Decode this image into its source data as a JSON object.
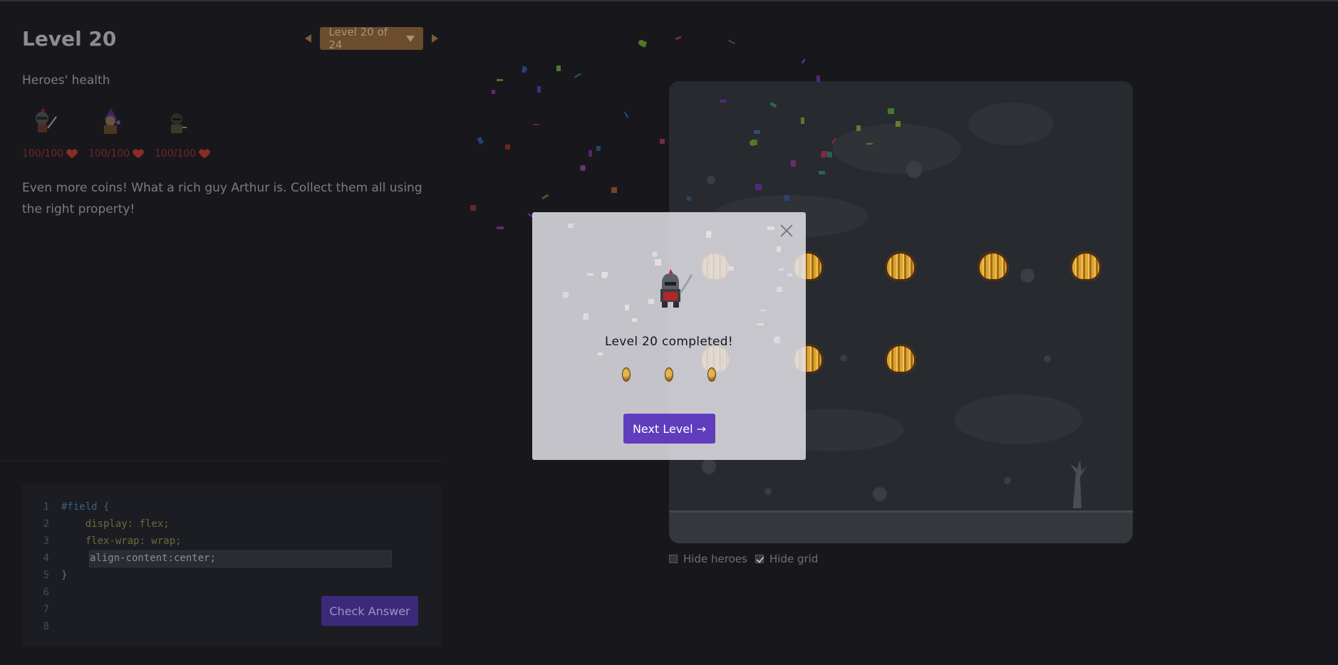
{
  "level": {
    "title": "Level 20",
    "selector_label": "Level 20 of 24"
  },
  "health": {
    "label": "Heroes' health",
    "heroes": [
      {
        "name": "knight",
        "hp": "100/100"
      },
      {
        "name": "wizard",
        "hp": "100/100"
      },
      {
        "name": "rogue",
        "hp": "100/100"
      }
    ]
  },
  "description": "Even more coins! What a rich guy Arthur is. Collect them all using the right property!",
  "editor": {
    "lines": [
      {
        "num": "1",
        "code": "#field {"
      },
      {
        "num": "2",
        "code": "    display: flex;"
      },
      {
        "num": "3",
        "code": "    flex-wrap: wrap;"
      },
      {
        "num": "4",
        "code": ""
      },
      {
        "num": "5",
        "code": "}"
      },
      {
        "num": "6",
        "code": ""
      },
      {
        "num": "7",
        "code": ""
      },
      {
        "num": "8",
        "code": ""
      }
    ],
    "input_value": "align-content:center;",
    "check_button": "Check Answer"
  },
  "field_options": {
    "hide_heroes_label": "Hide heroes",
    "hide_heroes_checked": false,
    "hide_grid_label": "Hide grid",
    "hide_grid_checked": true
  },
  "modal": {
    "title": "Level 20 completed!",
    "next_button": "Next Level →",
    "coins_earned": 3
  },
  "colors": {
    "accent_purple": "#5f3dbd",
    "level_select": "#6b4c2d",
    "health_red": "#8a2c25"
  }
}
